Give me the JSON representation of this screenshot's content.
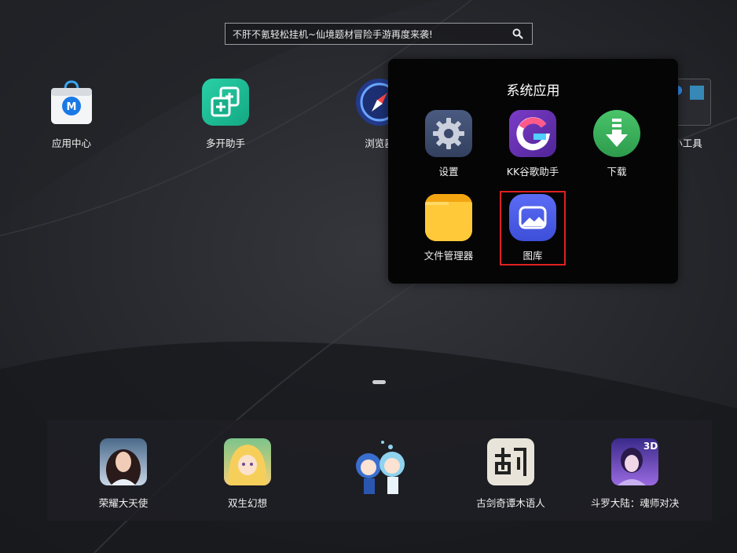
{
  "search": {
    "text": "不肝不氪轻松挂机~仙境题材冒险手游再度来袭!"
  },
  "desktop": {
    "apps": [
      {
        "label": "应用中心"
      },
      {
        "label": "多开助手"
      },
      {
        "label": "浏览器"
      },
      {
        "label": "小工具"
      }
    ]
  },
  "folder": {
    "title": "系统应用",
    "apps": [
      {
        "label": "设置"
      },
      {
        "label": "KK谷歌助手"
      },
      {
        "label": "下载"
      },
      {
        "label": "文件管理器"
      },
      {
        "label": "图库"
      }
    ]
  },
  "dock": {
    "apps": [
      {
        "label": "荣耀大天使"
      },
      {
        "label": "双生幻想"
      },
      {
        "label": ""
      },
      {
        "label": "古剑奇谭木语人"
      },
      {
        "label": "斗罗大陆：魂师对决"
      }
    ],
    "badge_3d": "3D"
  }
}
